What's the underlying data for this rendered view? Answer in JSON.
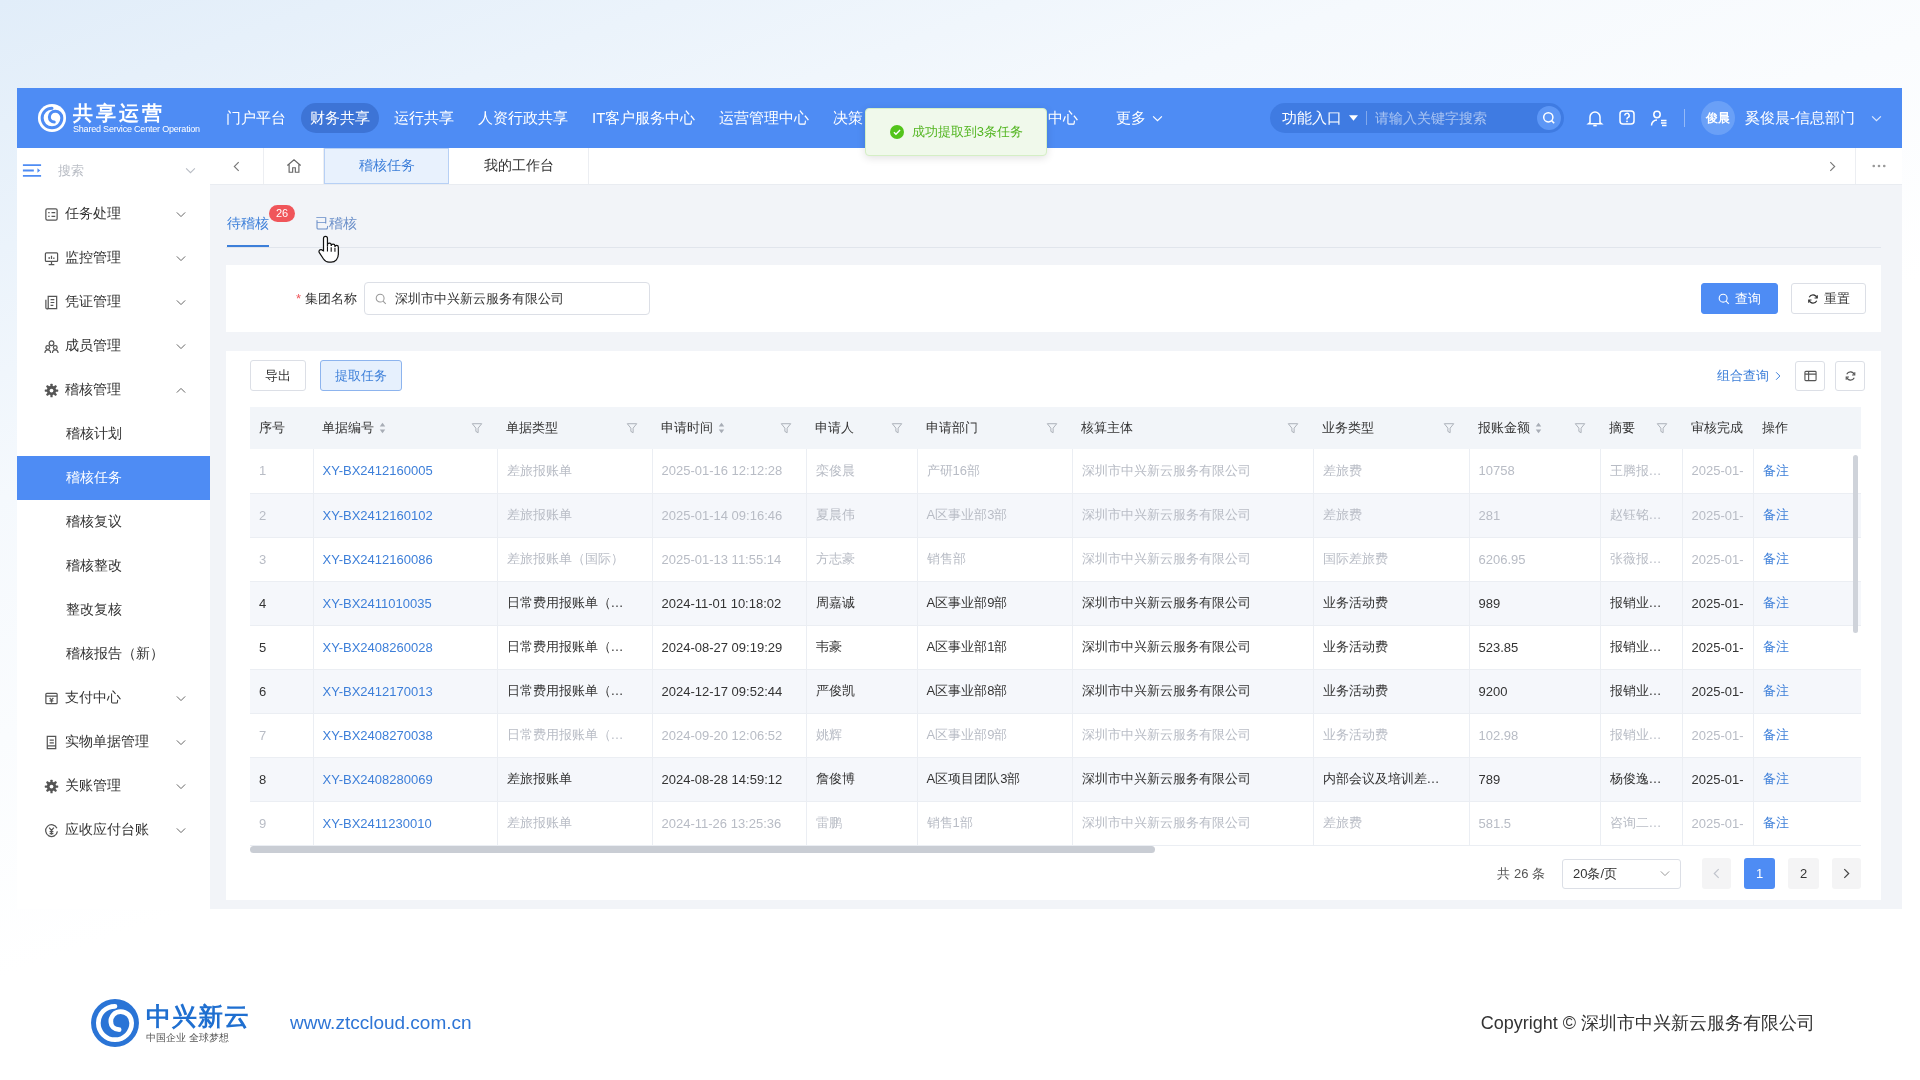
{
  "header": {
    "logo": {
      "title": "共享运营",
      "subtitle": "Shared Service Center Operation"
    },
    "nav": [
      {
        "label": "门户平台",
        "selected": false,
        "covered": false
      },
      {
        "label": "财务共享",
        "selected": true,
        "covered": false
      },
      {
        "label": "运行共享",
        "selected": false,
        "covered": false
      },
      {
        "label": "人资行政共享",
        "selected": false,
        "covered": false
      },
      {
        "label": "IT客户服务中心",
        "selected": false,
        "covered": false
      },
      {
        "label": "运营管理中心",
        "selected": false,
        "covered": false
      },
      {
        "label": "决策",
        "selected": false,
        "covered": true
      },
      {
        "label": "中心",
        "selected": false,
        "covered": false
      }
    ],
    "more": {
      "label": "更多"
    },
    "function_entry": {
      "label": "功能入口"
    },
    "search": {
      "placeholder": "请输入关键字搜索"
    },
    "user": {
      "avatar": "俊晨",
      "name": "奚俊晨-信息部门"
    }
  },
  "toast": {
    "message": "成功提取到3条任务"
  },
  "sidebar": {
    "search": {
      "placeholder": "搜索"
    },
    "items": [
      {
        "label": "任务处理",
        "expanded": false
      },
      {
        "label": "监控管理",
        "expanded": false
      },
      {
        "label": "凭证管理",
        "expanded": false
      },
      {
        "label": "成员管理",
        "expanded": false
      },
      {
        "label": "稽核管理",
        "expanded": true,
        "children": [
          {
            "label": "稽核计划",
            "selected": false
          },
          {
            "label": "稽核任务",
            "selected": true
          },
          {
            "label": "稽核复议",
            "selected": false
          },
          {
            "label": "稽核整改",
            "selected": false
          },
          {
            "label": "整改复核",
            "selected": false
          },
          {
            "label": "稽核报告（新）",
            "selected": false
          }
        ]
      },
      {
        "label": "支付中心",
        "expanded": false
      },
      {
        "label": "实物单据管理",
        "expanded": false
      },
      {
        "label": "关账管理",
        "expanded": false
      },
      {
        "label": "应收应付台账",
        "expanded": false
      }
    ]
  },
  "page_tabs": [
    {
      "label": "稽核任务",
      "selected": true
    },
    {
      "label": "我的工作台",
      "selected": false
    }
  ],
  "status_tabs": [
    {
      "label": "待稽核",
      "badge": "26",
      "selected": true
    },
    {
      "label": "已稽核",
      "selected": false
    }
  ],
  "filter": {
    "required_mark": "*",
    "label": "集团名称",
    "value": "深圳市中兴新云服务有限公司",
    "buttons": [
      {
        "label": "查询",
        "kind": "primary"
      },
      {
        "label": "重置",
        "kind": "default"
      }
    ]
  },
  "toolbar": {
    "buttons": [
      {
        "label": "导出",
        "selected": false
      },
      {
        "label": "提取任务",
        "selected": true
      }
    ],
    "advanced_query": "组合查询"
  },
  "table": {
    "columns": [
      {
        "label": "序号",
        "kind": "index",
        "sortable": false,
        "filterable": false
      },
      {
        "label": "单据编号",
        "kind": "link",
        "sortable": true,
        "filterable": true
      },
      {
        "label": "单据类型",
        "kind": "text",
        "sortable": false,
        "filterable": true
      },
      {
        "label": "申请时间",
        "kind": "text",
        "sortable": true,
        "filterable": true
      },
      {
        "label": "申请人",
        "kind": "text",
        "sortable": false,
        "filterable": true
      },
      {
        "label": "申请部门",
        "kind": "text",
        "sortable": false,
        "filterable": true
      },
      {
        "label": "核算主体",
        "kind": "text",
        "sortable": false,
        "filterable": true
      },
      {
        "label": "业务类型",
        "kind": "text",
        "sortable": false,
        "filterable": true
      },
      {
        "label": "报账金额",
        "kind": "text",
        "sortable": true,
        "filterable": true
      },
      {
        "label": "摘要",
        "kind": "text",
        "sortable": false,
        "filterable": true
      },
      {
        "label": "审核完成",
        "kind": "text",
        "sortable": false,
        "filterable": false
      },
      {
        "label": "操作",
        "kind": "action",
        "sortable": false,
        "filterable": false
      }
    ],
    "rows": [
      {
        "disabled": true,
        "cells": [
          "1",
          "XY-BX2412160005",
          "差旅报账单",
          "2025-01-16 12:12:28",
          "栾俊晨",
          "产研16部",
          "深圳市中兴新云服务有限公司",
          "差旅费",
          "10758",
          "王腾报…",
          "2025-01-",
          "备注"
        ]
      },
      {
        "disabled": true,
        "cells": [
          "2",
          "XY-BX2412160102",
          "差旅报账单",
          "2025-01-14 09:16:46",
          "夏晨伟",
          "A区事业部3部",
          "深圳市中兴新云服务有限公司",
          "差旅费",
          "281",
          "赵钰铭…",
          "2025-01-",
          "备注"
        ]
      },
      {
        "disabled": true,
        "cells": [
          "3",
          "XY-BX2412160086",
          "差旅报账单（国际）",
          "2025-01-13 11:55:14",
          "方志豪",
          "销售部",
          "深圳市中兴新云服务有限公司",
          "国际差旅费",
          "6206.95",
          "张薇报…",
          "2025-01-",
          "备注"
        ]
      },
      {
        "disabled": false,
        "cells": [
          "4",
          "XY-BX2411010035",
          "日常费用报账单（…",
          "2024-11-01 10:18:02",
          "周嘉诚",
          "A区事业部9部",
          "深圳市中兴新云服务有限公司",
          "业务活动费",
          "989",
          "报销业…",
          "2025-01-",
          "备注"
        ]
      },
      {
        "disabled": false,
        "cells": [
          "5",
          "XY-BX2408260028",
          "日常费用报账单（…",
          "2024-08-27 09:19:29",
          "韦豪",
          "A区事业部1部",
          "深圳市中兴新云服务有限公司",
          "业务活动费",
          "523.85",
          "报销业…",
          "2025-01-",
          "备注"
        ]
      },
      {
        "disabled": false,
        "cells": [
          "6",
          "XY-BX2412170013",
          "日常费用报账单（…",
          "2024-12-17 09:52:44",
          "严俊凯",
          "A区事业部8部",
          "深圳市中兴新云服务有限公司",
          "业务活动费",
          "9200",
          "报销业…",
          "2025-01-",
          "备注"
        ]
      },
      {
        "disabled": true,
        "cells": [
          "7",
          "XY-BX2408270038",
          "日常费用报账单（…",
          "2024-09-20 12:06:52",
          "姚辉",
          "A区事业部9部",
          "深圳市中兴新云服务有限公司",
          "业务活动费",
          "102.98",
          "报销业…",
          "2025-01-",
          "备注"
        ]
      },
      {
        "disabled": false,
        "cells": [
          "8",
          "XY-BX2408280069",
          "差旅报账单",
          "2024-08-28 14:59:12",
          "詹俊博",
          "A区项目团队3部",
          "深圳市中兴新云服务有限公司",
          "内部会议及培训差…",
          "789",
          "杨俊逸…",
          "2025-01-",
          "备注"
        ]
      },
      {
        "disabled": true,
        "cells": [
          "9",
          "XY-BX2411230010",
          "差旅报账单",
          "2024-11-26 13:25:36",
          "雷鹏",
          "销售1部",
          "深圳市中兴新云服务有限公司",
          "差旅费",
          "581.5",
          "咨询二…",
          "2025-01-",
          "备注"
        ]
      }
    ]
  },
  "pagination": {
    "total": "共 26 条",
    "page_size": "20条/页",
    "prev_disabled": true,
    "next_disabled": false,
    "pages": [
      {
        "label": "1",
        "selected": true
      },
      {
        "label": "2",
        "selected": false
      }
    ]
  },
  "footer": {
    "brand": "中兴新云",
    "tagline": "中国企业 全球梦想",
    "url": "www.ztccloud.com.cn",
    "copyright": "Copyright © 深圳市中兴新云服务有限公司"
  }
}
